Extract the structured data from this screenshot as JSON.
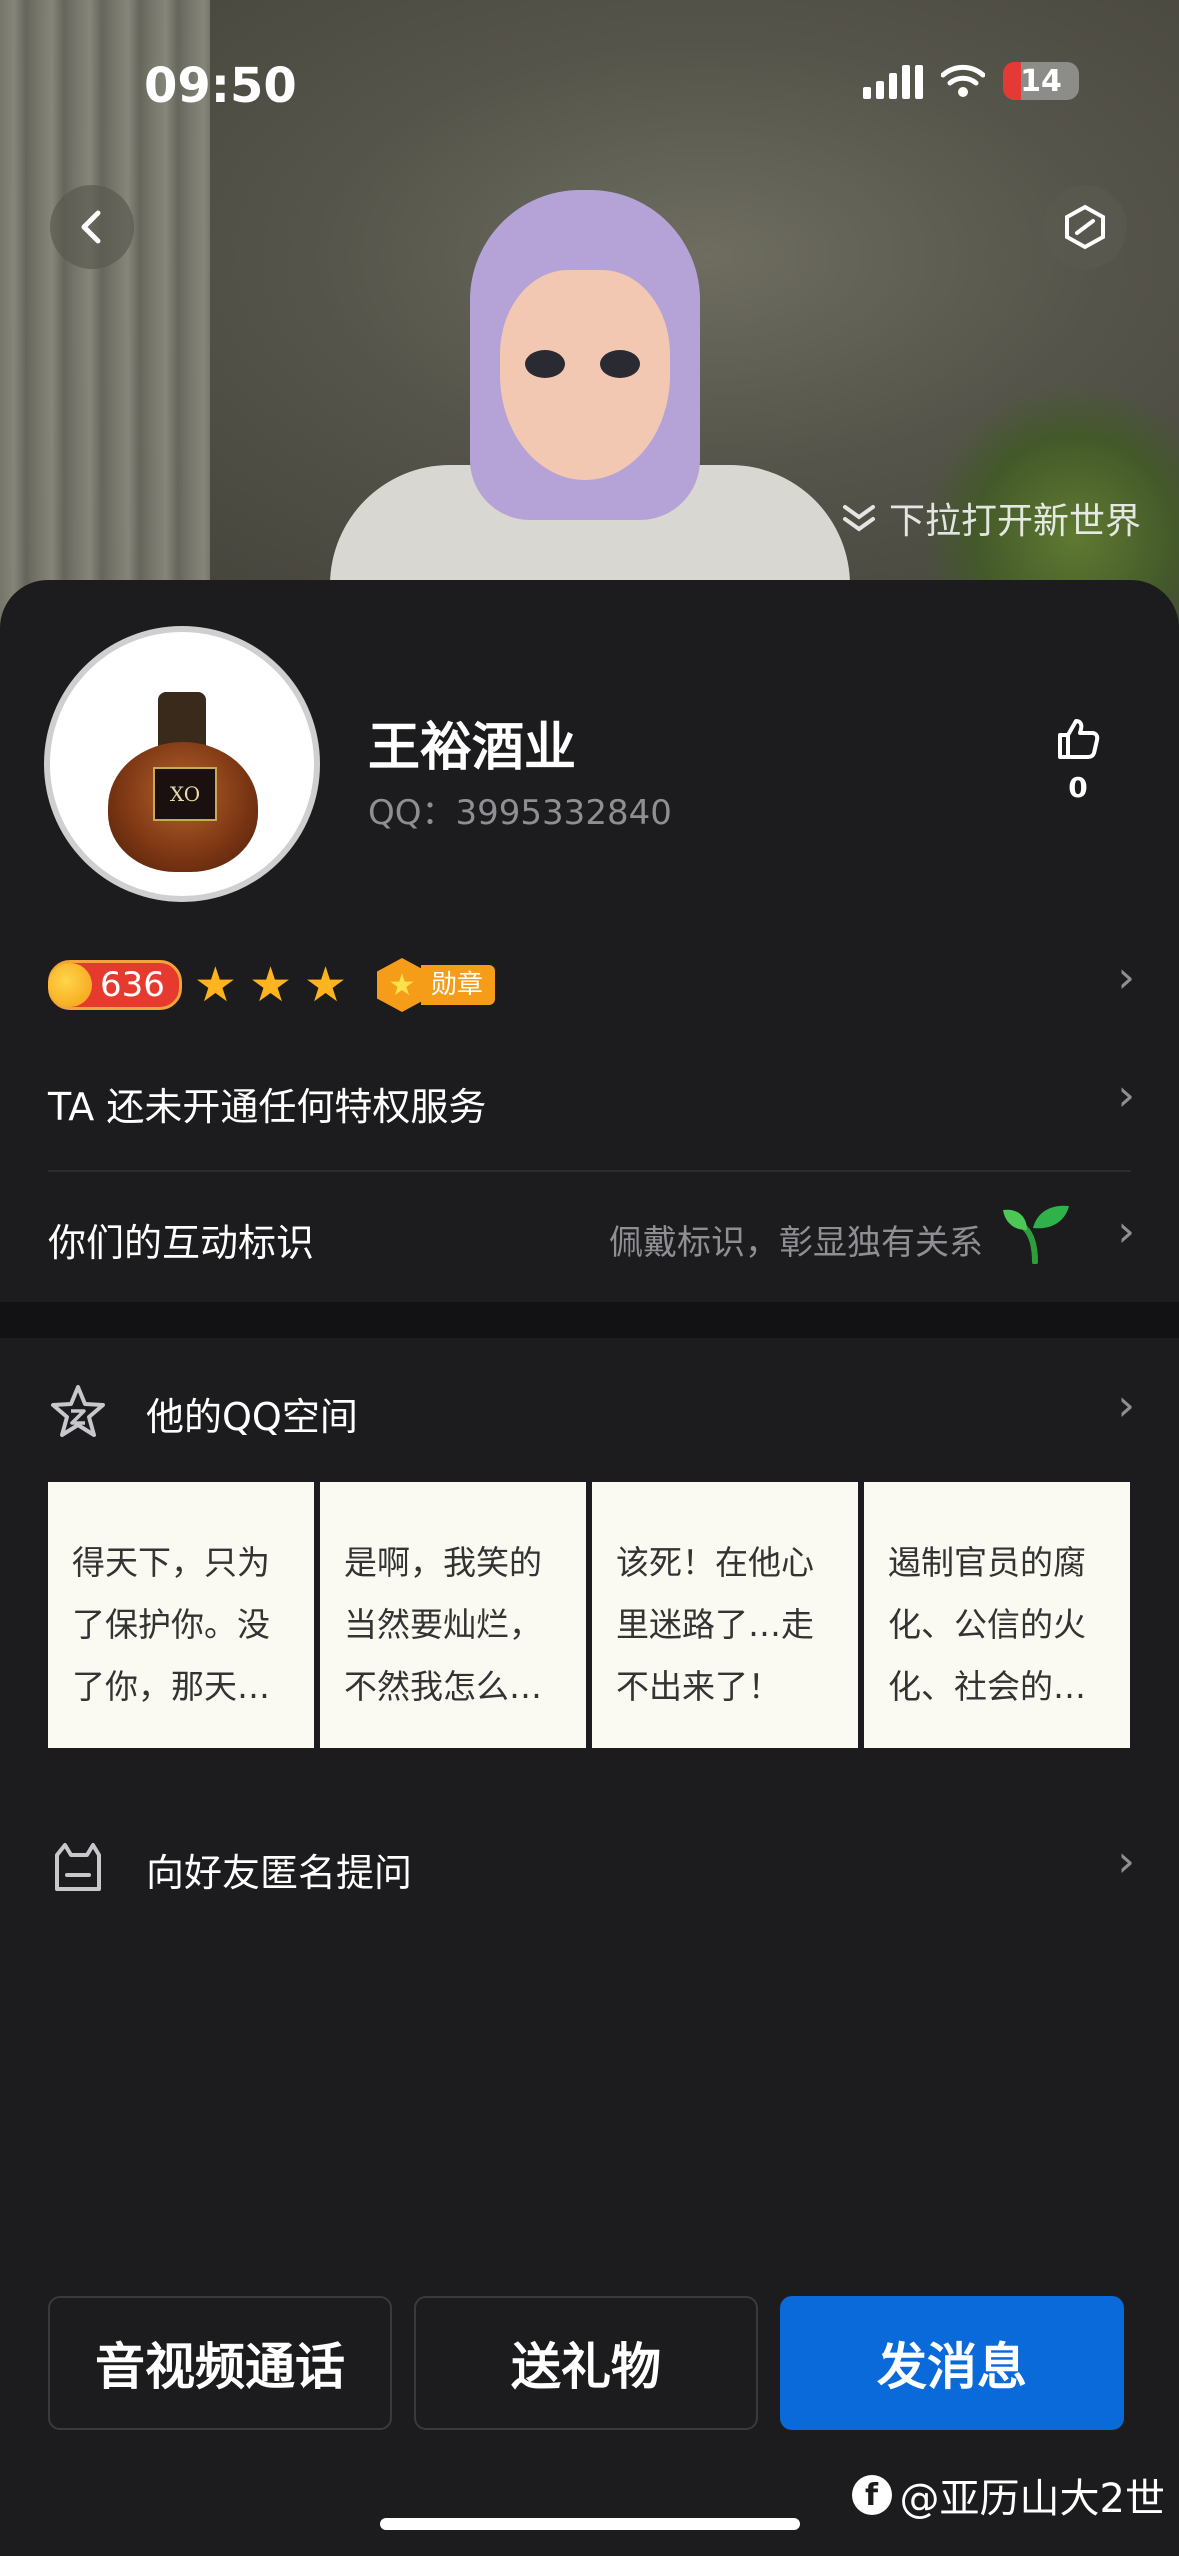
{
  "status_bar": {
    "time": "09:50",
    "battery": "14"
  },
  "hero": {
    "pull_hint": "下拉打开新世界"
  },
  "profile": {
    "name": "王裕酒业",
    "qq_label": "QQ：3995332840",
    "likes": "0",
    "level": "636",
    "stars": 3,
    "medal_label": "勋章",
    "bottle_label": "XO"
  },
  "rows": {
    "privilege": "TA 还未开通任何特权服务",
    "interaction": "你们的互动标识",
    "interaction_hint": "佩戴标识，彰显独有关系"
  },
  "qzone": {
    "title": "他的QQ空间",
    "posts": [
      "得天下，只为了保护你。没了你，那天…",
      "是啊，我笑的当然要灿烂，不然我怎么…",
      "该死！在他心里迷路了…走不出来了！",
      "遏制官员的腐化、公信的火化、社会的…"
    ]
  },
  "anon_question": {
    "title": "向好友匿名提问"
  },
  "actions": {
    "call": "音视频通话",
    "gift": "送礼物",
    "message": "发消息"
  },
  "watermark": "@亚历山大2世",
  "colors": {
    "primary": "#0b6ad9",
    "background": "#1c1c1e",
    "star": "#ffb41f"
  }
}
